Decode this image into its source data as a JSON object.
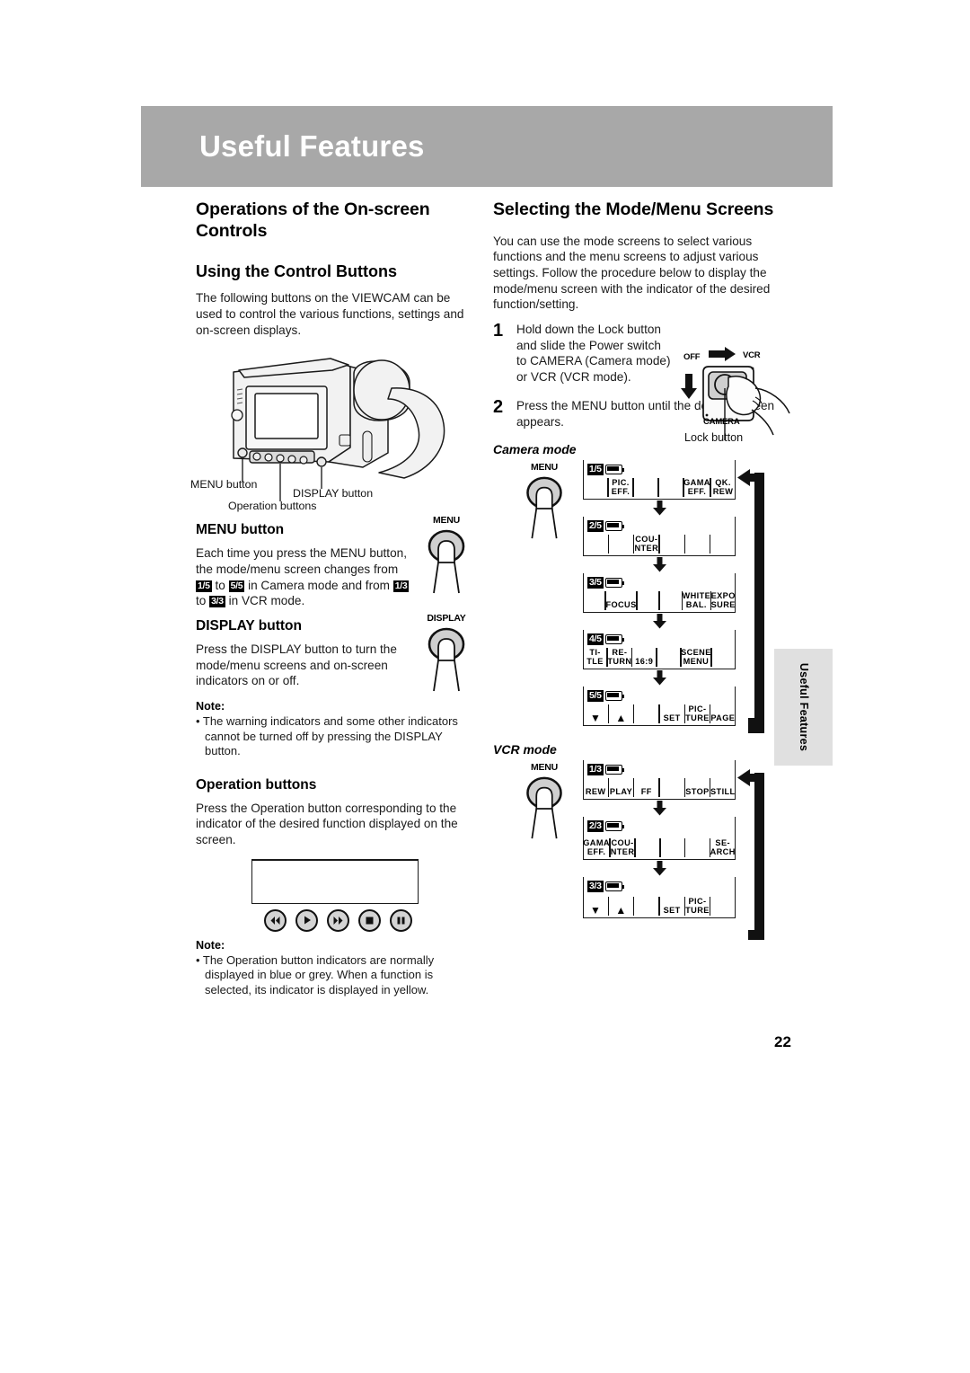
{
  "header": {
    "title": "Useful Features"
  },
  "page_number": "22",
  "side_tab": "Useful Features",
  "left_column": {
    "section_title": "Operations of the On-screen Controls",
    "subsection_title": "Using the Control Buttons",
    "intro": "The following buttons on the VIEWCAM can be used to control the various functions, settings and on-screen displays.",
    "camcorder_callouts": {
      "menu": "MENU button",
      "display": "DISPLAY button",
      "operation": "Operation buttons"
    },
    "menu_button": {
      "heading": "MENU button",
      "text_part1": "Each time you press the MENU button, the mode/menu screen changes from ",
      "frac_1_5": "1/5",
      "text_to_a": " to ",
      "frac_5_5": "5/5",
      "text_part2": " in Camera mode and from ",
      "frac_1_3": "1/3",
      "text_to_b": " to ",
      "frac_3_3": "3/3",
      "text_part3": " in VCR mode.",
      "button_caption": "MENU"
    },
    "display_button": {
      "heading": "DISPLAY button",
      "text": "Press the DISPLAY button to turn the mode/menu screens and on-screen indicators on or off.",
      "button_caption": "DISPLAY",
      "note_head": "Note:",
      "note_text": "• The warning indicators and some other indicators cannot be turned off by pressing the DISPLAY button."
    },
    "operation_buttons": {
      "heading": "Operation buttons",
      "text": "Press the Operation button corresponding to the indicator of the desired function displayed on the screen.",
      "icons": [
        "rewind-icon",
        "play-icon",
        "fast-forward-icon",
        "stop-icon",
        "pause-icon"
      ],
      "note_head": "Note:",
      "note_text": "• The Operation button indicators are normally displayed in blue or grey. When a function is selected, its indicator is displayed in yellow."
    }
  },
  "right_column": {
    "section_title": "Selecting the Mode/Menu Screens",
    "intro": "You can use the mode screens to select various functions and the menu screens to adjust various settings. Follow the procedure below to display the mode/menu screen with the indicator of the desired function/setting.",
    "steps": [
      {
        "num": "1",
        "text": "Hold down the Lock button and slide the Power switch to CAMERA (Camera mode) or VCR (VCR mode)."
      },
      {
        "num": "2",
        "text": "Press the MENU button until the desired screen appears."
      }
    ],
    "power_switch": {
      "off_label": "OFF",
      "vcr_label": "VCR",
      "camera_label": "CAMERA",
      "lock_caption": "Lock button"
    },
    "camera_mode": {
      "label": "Camera mode",
      "menu_caption": "MENU",
      "screens": [
        {
          "badge": "1/5",
          "slots": [
            "",
            "PIC.\nEFF.",
            "",
            "",
            "GAMA\nEFF.",
            "QK.\nREW"
          ]
        },
        {
          "badge": "2/5",
          "slots": [
            "",
            "",
            "COU-\nNTER",
            "",
            "",
            ""
          ]
        },
        {
          "badge": "3/5",
          "slots": [
            "",
            "FOCUS",
            "",
            "",
            "WHITE\nBAL.",
            "EXPO\nSURE"
          ]
        },
        {
          "badge": "4/5",
          "slots": [
            "TI-\nTLE",
            "RE-\nTURN",
            "16:9",
            "",
            "SCENE\nMENU",
            ""
          ]
        },
        {
          "badge": "5/5",
          "slots": [
            "▼",
            "▲",
            "",
            "SET",
            "PIC-\nTURE",
            "PAGE"
          ]
        }
      ]
    },
    "vcr_mode": {
      "label": "VCR mode",
      "menu_caption": "MENU",
      "screens": [
        {
          "badge": "1/3",
          "slots": [
            "REW",
            "PLAY",
            "FF",
            "",
            "STOP",
            "STILL"
          ]
        },
        {
          "badge": "2/3",
          "slots": [
            "GAMA\nEFF.",
            "COU-\nNTER",
            "",
            "",
            "",
            "SE-\nARCH"
          ]
        },
        {
          "badge": "3/3",
          "slots": [
            "▼",
            "▲",
            "",
            "SET",
            "PIC-\nTURE",
            ""
          ]
        }
      ]
    }
  }
}
